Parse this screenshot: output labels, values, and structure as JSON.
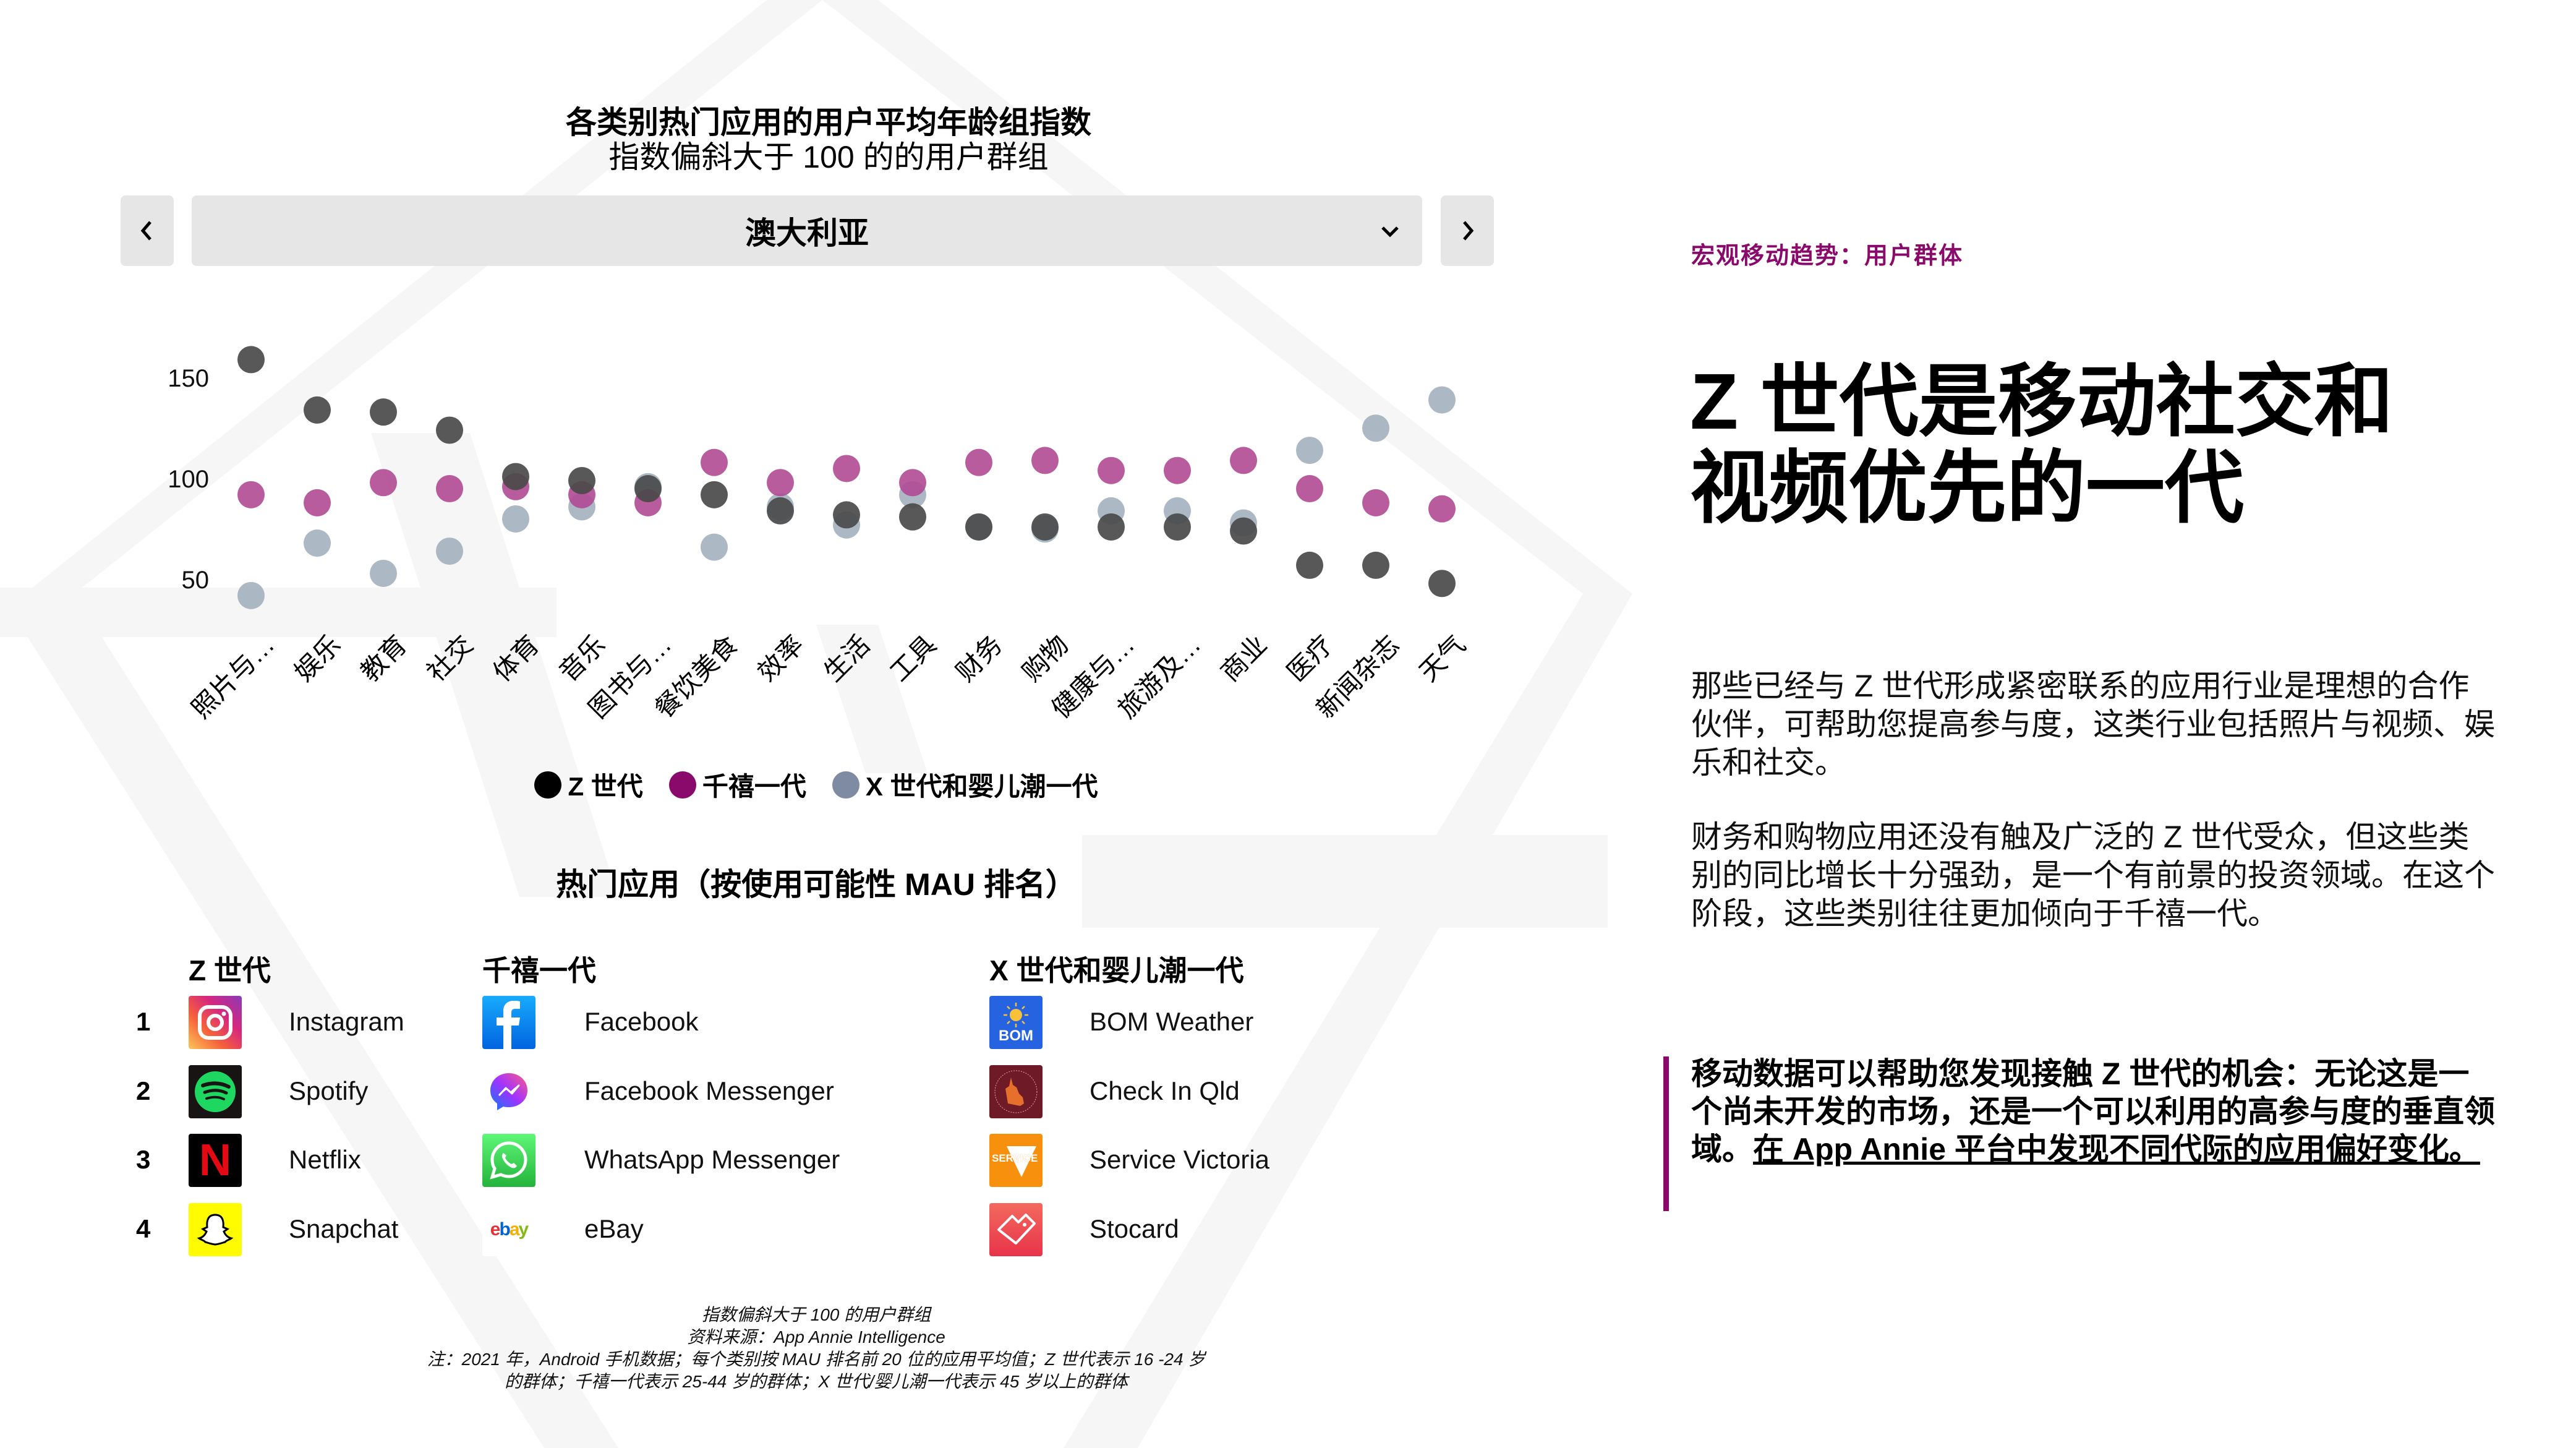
{
  "chart_section": {
    "title": "各类别热门应用的用户平均年龄组指数",
    "subtitle": "指数偏斜大于 100 的的用户群组",
    "region_selector": {
      "selected": "澳大利亚",
      "prev_icon": "chevron-left-icon",
      "next_icon": "chevron-right-icon",
      "dropdown_icon": "chevron-down-icon"
    }
  },
  "chart_data": {
    "type": "scatter",
    "title": "各类别热门应用的用户平均年龄组指数",
    "subtitle": "指数偏斜大于 100 的的用户群组",
    "xlabel": "",
    "ylabel": "",
    "yticks": [
      50,
      100,
      150
    ],
    "ylim": [
      40,
      165
    ],
    "grid": false,
    "legend_position": "bottom",
    "categories": [
      "照片与…",
      "娱乐",
      "教育",
      "社交",
      "体育",
      "音乐",
      "图书与…",
      "餐饮美食",
      "效率",
      "生活",
      "工具",
      "财务",
      "购物",
      "健康与…",
      "旅游及…",
      "商业",
      "医疗",
      "新闻杂志",
      "天气"
    ],
    "series": [
      {
        "name": "Z 世代",
        "color": "#4a4a4a",
        "legend_color": "#000000",
        "values": [
          160,
          135,
          134,
          125,
          102,
          100,
          96,
          93,
          85,
          83,
          82,
          77,
          77,
          77,
          77,
          75,
          58,
          58,
          49
        ]
      },
      {
        "name": "千禧一代",
        "color": "#b04a94",
        "legend_color": "#8a0a6b",
        "values": [
          93,
          89,
          99,
          96,
          97,
          93,
          89,
          109,
          99,
          106,
          99,
          109,
          110,
          105,
          105,
          110,
          96,
          89,
          86
        ]
      },
      {
        "name": "X 世代和婴儿潮一代",
        "color": "#a2aebd",
        "legend_color": "#7e8ba3",
        "values": [
          43,
          69,
          54,
          65,
          81,
          87,
          97,
          67,
          87,
          78,
          93,
          77,
          76,
          85,
          85,
          79,
          115,
          126,
          140
        ]
      }
    ]
  },
  "legend": [
    {
      "label": "Z 世代",
      "color": "#000000"
    },
    {
      "label": "千禧一代",
      "color": "#8a0a6b"
    },
    {
      "label": "X 世代和婴儿潮一代",
      "color": "#7e8ba3"
    }
  ],
  "top_apps": {
    "title": "热门应用（按使用可能性 MAU 排名）",
    "ranks": [
      "1",
      "2",
      "3",
      "4"
    ],
    "columns": [
      {
        "header": "Z 世代",
        "apps": [
          {
            "name": "Instagram",
            "icon": "instagram-icon"
          },
          {
            "name": "Spotify",
            "icon": "spotify-icon"
          },
          {
            "name": "Netflix",
            "icon": "netflix-icon"
          },
          {
            "name": "Snapchat",
            "icon": "snapchat-icon"
          }
        ]
      },
      {
        "header": "千禧一代",
        "apps": [
          {
            "name": "Facebook",
            "icon": "facebook-icon"
          },
          {
            "name": "Facebook Messenger",
            "icon": "messenger-icon"
          },
          {
            "name": "WhatsApp Messenger",
            "icon": "whatsapp-icon"
          },
          {
            "name": "eBay",
            "icon": "ebay-icon"
          }
        ]
      },
      {
        "header": "X 世代和婴儿潮一代",
        "apps": [
          {
            "name": "BOM Weather",
            "icon": "bom-weather-icon"
          },
          {
            "name": "Check In Qld",
            "icon": "check-in-qld-icon"
          },
          {
            "name": "Service Victoria",
            "icon": "service-victoria-icon"
          },
          {
            "name": "Stocard",
            "icon": "stocard-icon"
          }
        ]
      }
    ],
    "icon_texts": {
      "bom": "BOM",
      "service": "SERVICE",
      "ebay": [
        "e",
        "b",
        "a",
        "y"
      ],
      "netflix": "N"
    }
  },
  "footnotes": [
    "指数偏斜大于 100 的用户群组",
    "资料来源：App Annie Intelligence",
    "注：2021 年，Android 手机数据；每个类别按 MAU 排名前 20 位的应用平均值；Z 世代表示 16 -24 岁",
    "的群体；千禧一代表示 25-44 岁的群体；X 世代/婴儿潮一代表示 45 岁以上的群体"
  ],
  "right_panel": {
    "kicker": "宏观移动趋势：用户群体",
    "headline_line1": "Z 世代是移动社交和",
    "headline_line2": "视频优先的一代",
    "paragraph1": "那些已经与 Z 世代形成紧密联系的应用行业是理想的合作伙伴，可帮助您提高参与度，这类行业包括照片与视频、娱乐和社交。",
    "paragraph2": "财务和购物应用还没有触及广泛的 Z 世代受众，但这些类别的同比增长十分强劲，是一个有前景的投资领域。在这个阶段，这些类别往往更加倾向于千禧一代。",
    "callout_text": "移动数据可以帮助您发现接触 Z 世代的机会：无论这是一个尚未开发的市场，还是一个可以利用的高参与度的垂直领域。",
    "callout_link": "在 App Annie 平台中发现不同代际的应用偏好变化。",
    "accent_color": "#8a0a6b"
  }
}
